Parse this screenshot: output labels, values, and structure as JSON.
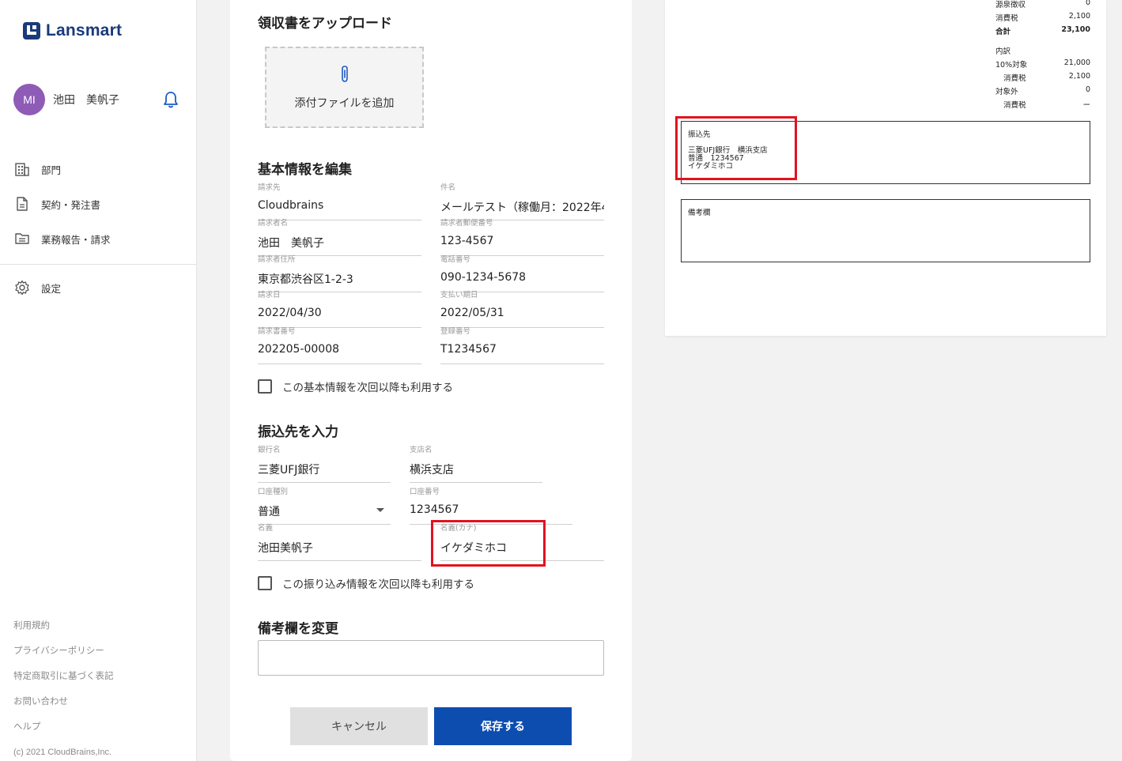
{
  "app": {
    "brand": "Lansmart",
    "brand_color": "#1a3a7a",
    "accent": "#0d4db0"
  },
  "user": {
    "initials": "MI",
    "name": "池田　美帆子",
    "avatar_color": "#8e5bb6"
  },
  "nav": [
    {
      "label": "部門",
      "icon": "building-icon"
    },
    {
      "label": "契約・発注書",
      "icon": "document-icon"
    },
    {
      "label": "業務報告・請求",
      "icon": "folder-icon"
    }
  ],
  "nav_settings": {
    "label": "設定",
    "icon": "gear-icon"
  },
  "footer": {
    "links": [
      "利用規約",
      "プライバシーポリシー",
      "特定商取引に基づく表記",
      "お問い合わせ",
      "ヘルプ"
    ],
    "copyright": "(c) 2021 CloudBrains,Inc."
  },
  "form": {
    "upload": {
      "title": "領収書をアップロード",
      "add_label": "添付ファイルを追加"
    },
    "basic": {
      "title": "基本情報を編集",
      "fields": {
        "billing_to": {
          "label": "請求先",
          "value": "Cloudbrains"
        },
        "subject": {
          "label": "件名",
          "value": "メールテスト（稼働月：2022年4"
        },
        "biller_name": {
          "label": "請求者名",
          "value": "池田　美帆子"
        },
        "postal": {
          "label": "請求者郵便番号",
          "value": "123-4567"
        },
        "address": {
          "label": "請求者住所",
          "value": "東京都渋谷区1-2-3"
        },
        "phone": {
          "label": "電話番号",
          "value": "090-1234-5678"
        },
        "billing_date": {
          "label": "請求日",
          "value": "2022/04/30"
        },
        "due_date": {
          "label": "支払い期日",
          "value": "2022/05/31"
        },
        "invoice_no": {
          "label": "請求書番号",
          "value": "202205-00008"
        },
        "reg_no": {
          "label": "登録番号",
          "value": "T1234567"
        }
      },
      "reuse_label": "この基本情報を次回以降も利用する"
    },
    "bank": {
      "title": "振込先を入力",
      "fields": {
        "bank_name": {
          "label": "銀行名",
          "value": "三菱UFJ銀行"
        },
        "branch": {
          "label": "支店名",
          "value": "横浜支店"
        },
        "account_type": {
          "label": "口座種別",
          "value": "普通"
        },
        "account_no": {
          "label": "口座番号",
          "value": "1234567"
        },
        "holder": {
          "label": "名義",
          "value": "池田美帆子"
        },
        "holder_kana": {
          "label": "名義(カナ)",
          "value": "イケダミホコ"
        }
      },
      "reuse_label": "この振り込み情報を次回以降も利用する"
    },
    "remarks": {
      "title": "備考欄を変更",
      "value": ""
    },
    "buttons": {
      "cancel": "キャンセル",
      "save": "保存する"
    }
  },
  "preview": {
    "summary": [
      {
        "label": "源泉徴収",
        "value": "0"
      },
      {
        "label": "消費税",
        "value": "2,100"
      },
      {
        "label": "合計",
        "value": "23,100"
      }
    ],
    "breakdown_title": "内訳",
    "breakdown": [
      {
        "label": "10%対象",
        "value": "21,000"
      },
      {
        "label": "消費税",
        "value": "2,100"
      },
      {
        "label": "対象外",
        "value": "0"
      },
      {
        "label": "消費税",
        "value": "ー"
      }
    ],
    "bank_box": {
      "title": "振込先",
      "line1": "三菱UFJ銀行　横浜支店",
      "line2": "普通　1234567",
      "line3": "イケダミホコ"
    },
    "remarks_box": {
      "title": "備考欄"
    }
  }
}
